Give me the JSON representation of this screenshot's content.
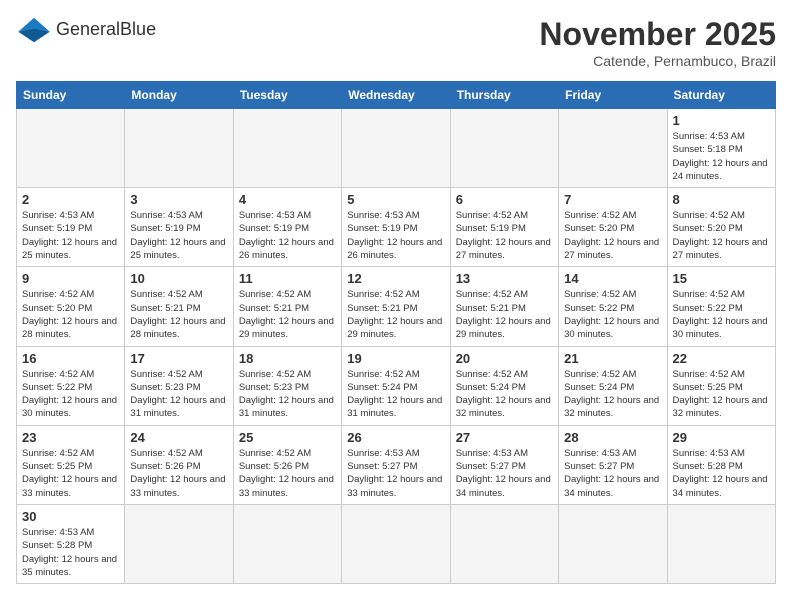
{
  "header": {
    "logo_general": "General",
    "logo_blue": "Blue",
    "month_year": "November 2025",
    "subtitle": "Catende, Pernambuco, Brazil"
  },
  "weekdays": [
    "Sunday",
    "Monday",
    "Tuesday",
    "Wednesday",
    "Thursday",
    "Friday",
    "Saturday"
  ],
  "days": [
    {
      "date": null,
      "info": ""
    },
    {
      "date": null,
      "info": ""
    },
    {
      "date": null,
      "info": ""
    },
    {
      "date": null,
      "info": ""
    },
    {
      "date": null,
      "info": ""
    },
    {
      "date": null,
      "info": ""
    },
    {
      "date": "1",
      "info": "Sunrise: 4:53 AM\nSunset: 5:18 PM\nDaylight: 12 hours and 24 minutes."
    },
    {
      "date": "2",
      "info": "Sunrise: 4:53 AM\nSunset: 5:19 PM\nDaylight: 12 hours and 25 minutes."
    },
    {
      "date": "3",
      "info": "Sunrise: 4:53 AM\nSunset: 5:19 PM\nDaylight: 12 hours and 25 minutes."
    },
    {
      "date": "4",
      "info": "Sunrise: 4:53 AM\nSunset: 5:19 PM\nDaylight: 12 hours and 26 minutes."
    },
    {
      "date": "5",
      "info": "Sunrise: 4:53 AM\nSunset: 5:19 PM\nDaylight: 12 hours and 26 minutes."
    },
    {
      "date": "6",
      "info": "Sunrise: 4:52 AM\nSunset: 5:19 PM\nDaylight: 12 hours and 27 minutes."
    },
    {
      "date": "7",
      "info": "Sunrise: 4:52 AM\nSunset: 5:20 PM\nDaylight: 12 hours and 27 minutes."
    },
    {
      "date": "8",
      "info": "Sunrise: 4:52 AM\nSunset: 5:20 PM\nDaylight: 12 hours and 27 minutes."
    },
    {
      "date": "9",
      "info": "Sunrise: 4:52 AM\nSunset: 5:20 PM\nDaylight: 12 hours and 28 minutes."
    },
    {
      "date": "10",
      "info": "Sunrise: 4:52 AM\nSunset: 5:21 PM\nDaylight: 12 hours and 28 minutes."
    },
    {
      "date": "11",
      "info": "Sunrise: 4:52 AM\nSunset: 5:21 PM\nDaylight: 12 hours and 29 minutes."
    },
    {
      "date": "12",
      "info": "Sunrise: 4:52 AM\nSunset: 5:21 PM\nDaylight: 12 hours and 29 minutes."
    },
    {
      "date": "13",
      "info": "Sunrise: 4:52 AM\nSunset: 5:21 PM\nDaylight: 12 hours and 29 minutes."
    },
    {
      "date": "14",
      "info": "Sunrise: 4:52 AM\nSunset: 5:22 PM\nDaylight: 12 hours and 30 minutes."
    },
    {
      "date": "15",
      "info": "Sunrise: 4:52 AM\nSunset: 5:22 PM\nDaylight: 12 hours and 30 minutes."
    },
    {
      "date": "16",
      "info": "Sunrise: 4:52 AM\nSunset: 5:22 PM\nDaylight: 12 hours and 30 minutes."
    },
    {
      "date": "17",
      "info": "Sunrise: 4:52 AM\nSunset: 5:23 PM\nDaylight: 12 hours and 31 minutes."
    },
    {
      "date": "18",
      "info": "Sunrise: 4:52 AM\nSunset: 5:23 PM\nDaylight: 12 hours and 31 minutes."
    },
    {
      "date": "19",
      "info": "Sunrise: 4:52 AM\nSunset: 5:24 PM\nDaylight: 12 hours and 31 minutes."
    },
    {
      "date": "20",
      "info": "Sunrise: 4:52 AM\nSunset: 5:24 PM\nDaylight: 12 hours and 32 minutes."
    },
    {
      "date": "21",
      "info": "Sunrise: 4:52 AM\nSunset: 5:24 PM\nDaylight: 12 hours and 32 minutes."
    },
    {
      "date": "22",
      "info": "Sunrise: 4:52 AM\nSunset: 5:25 PM\nDaylight: 12 hours and 32 minutes."
    },
    {
      "date": "23",
      "info": "Sunrise: 4:52 AM\nSunset: 5:25 PM\nDaylight: 12 hours and 33 minutes."
    },
    {
      "date": "24",
      "info": "Sunrise: 4:52 AM\nSunset: 5:26 PM\nDaylight: 12 hours and 33 minutes."
    },
    {
      "date": "25",
      "info": "Sunrise: 4:52 AM\nSunset: 5:26 PM\nDaylight: 12 hours and 33 minutes."
    },
    {
      "date": "26",
      "info": "Sunrise: 4:53 AM\nSunset: 5:27 PM\nDaylight: 12 hours and 33 minutes."
    },
    {
      "date": "27",
      "info": "Sunrise: 4:53 AM\nSunset: 5:27 PM\nDaylight: 12 hours and 34 minutes."
    },
    {
      "date": "28",
      "info": "Sunrise: 4:53 AM\nSunset: 5:27 PM\nDaylight: 12 hours and 34 minutes."
    },
    {
      "date": "29",
      "info": "Sunrise: 4:53 AM\nSunset: 5:28 PM\nDaylight: 12 hours and 34 minutes."
    },
    {
      "date": "30",
      "info": "Sunrise: 4:53 AM\nSunset: 5:28 PM\nDaylight: 12 hours and 35 minutes."
    },
    {
      "date": null,
      "info": ""
    },
    {
      "date": null,
      "info": ""
    },
    {
      "date": null,
      "info": ""
    },
    {
      "date": null,
      "info": ""
    },
    {
      "date": null,
      "info": ""
    },
    {
      "date": null,
      "info": ""
    }
  ]
}
